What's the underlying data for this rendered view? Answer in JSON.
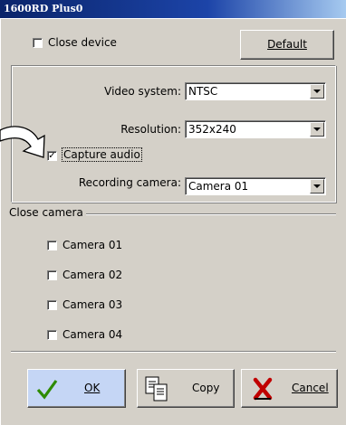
{
  "window": {
    "title": "1600RD Plus0"
  },
  "top": {
    "close_device_label": "Close device",
    "default_button_label": "Default"
  },
  "settings": {
    "video_system_label": "Video system:",
    "video_system_value": "NTSC",
    "resolution_label": "Resolution:",
    "resolution_value": "352x240",
    "capture_audio_label": "Capture audio",
    "capture_audio_checked": true,
    "recording_camera_label": "Recording camera:",
    "recording_camera_value": "Camera 01"
  },
  "close_camera": {
    "group_label": "Close camera",
    "cameras": [
      {
        "label": "Camera 01",
        "checked": false
      },
      {
        "label": "Camera 02",
        "checked": false
      },
      {
        "label": "Camera 03",
        "checked": false
      },
      {
        "label": "Camera 04",
        "checked": false
      }
    ]
  },
  "footer": {
    "ok_label": "OK",
    "copy_label": "Copy",
    "cancel_label": "Cancel"
  },
  "icons": {
    "ok": "checkmark-icon",
    "copy": "copy-pages-icon",
    "cancel": "red-x-icon",
    "callout": "curved-arrow-icon"
  },
  "colors": {
    "titlebar": "#0a246a",
    "dialog": "#d4d0c8",
    "ok_check": "#2e8b00",
    "cancel_x": "#c00000"
  }
}
